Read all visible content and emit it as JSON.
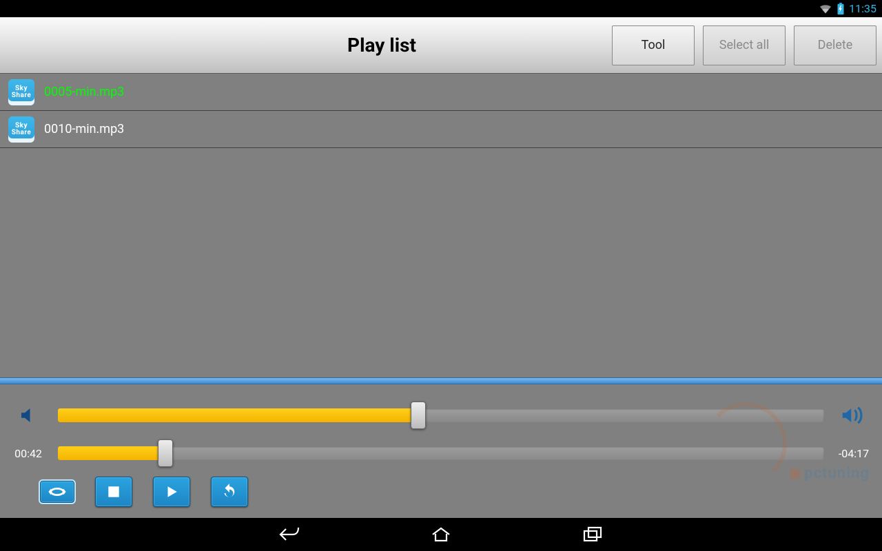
{
  "status": {
    "time": "11:35"
  },
  "header": {
    "title": "Play list",
    "tool_label": "Tool",
    "select_all_label": "Select all",
    "delete_label": "Delete"
  },
  "playlist": {
    "items": [
      {
        "name": "0005-min.mp3",
        "playing": true
      },
      {
        "name": "0010-min.mp3",
        "playing": false
      }
    ]
  },
  "player": {
    "volume_percent": 47,
    "elapsed": "00:42",
    "remaining": "-04:17",
    "progress_percent": 14
  },
  "skyshare": {
    "line1": "Sky",
    "line2": "Share"
  },
  "watermark": {
    "text": "pctuning"
  }
}
